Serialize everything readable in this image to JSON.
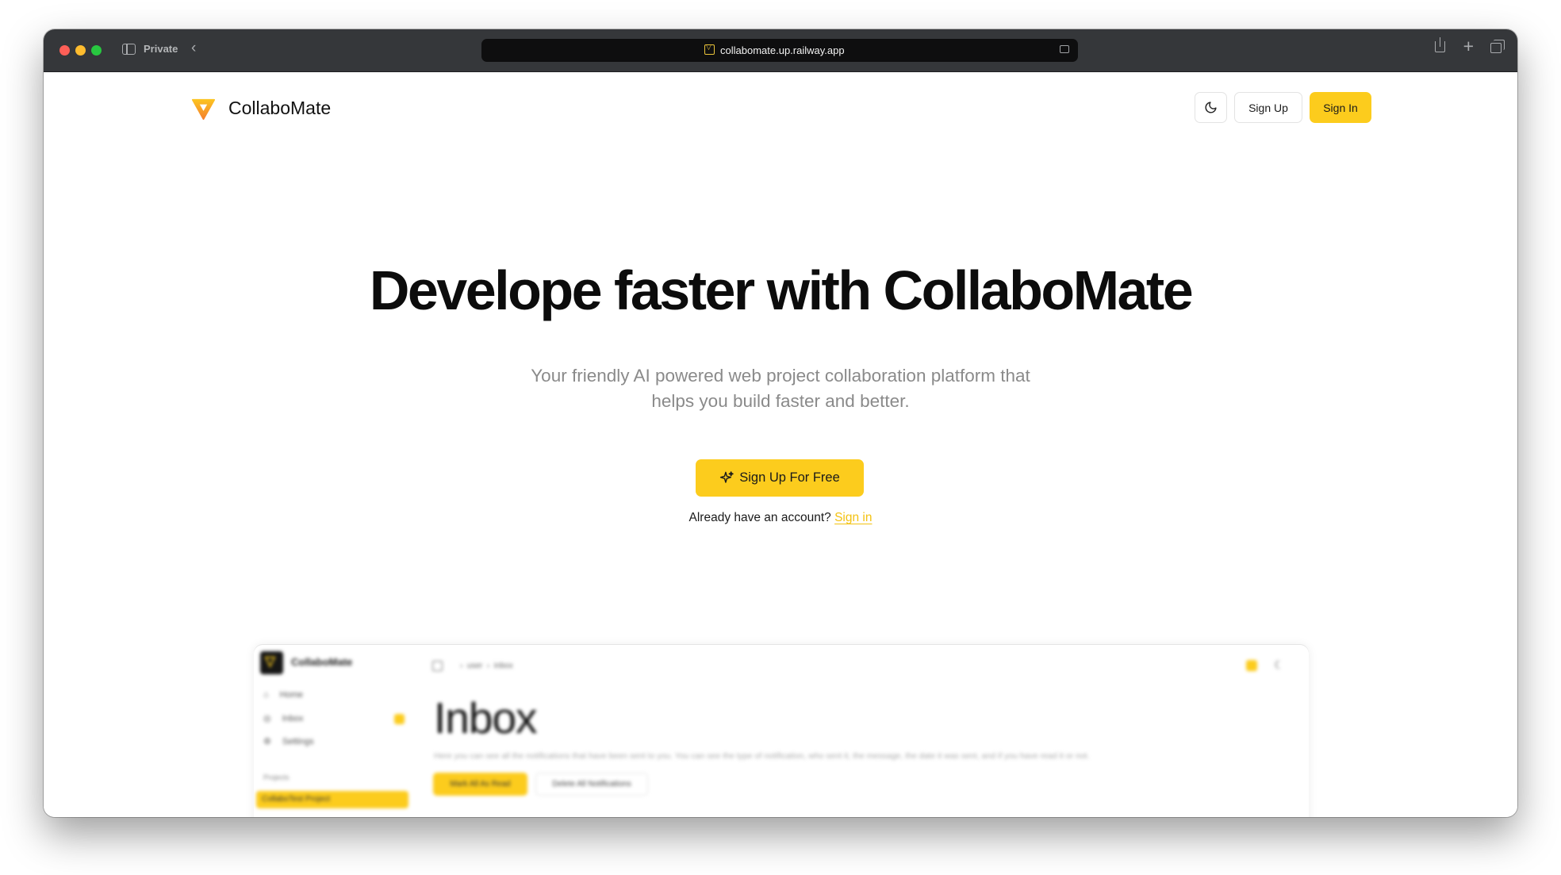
{
  "browser": {
    "private_label": "Private",
    "url": "collabomate.up.railway.app"
  },
  "nav": {
    "brand": "CollaboMate",
    "theme_icon": "moon-icon",
    "signup_label": "Sign Up",
    "signin_label": "Sign In"
  },
  "hero": {
    "title": "Develope faster with CollaboMate",
    "subtitle": "Your friendly AI powered web project collaboration platform that helps you build faster and better.",
    "cta_label": "Sign Up For Free",
    "cta_icon": "sparkles-icon",
    "account_prompt": "Already have an account?",
    "signin_link": "Sign in"
  },
  "preview": {
    "brand": "CollaboMate",
    "sidebar": [
      "Home",
      "Inbox",
      "Settings"
    ],
    "projects_label": "Projects",
    "project_select": "CollaboTest Project",
    "breadcrumb": [
      "user",
      "inbox"
    ],
    "page_title": "Inbox",
    "description": "Here you can see all the notifications that have been sent to you. You can see the type of notification, who sent it, the message, the date it was sent, and if you have read it or not.",
    "mark_all_label": "Mark All As Read",
    "delete_all_label": "Delete All Notifications"
  },
  "colors": {
    "accent": "#fccc1d",
    "titlebar": "#35373a"
  }
}
